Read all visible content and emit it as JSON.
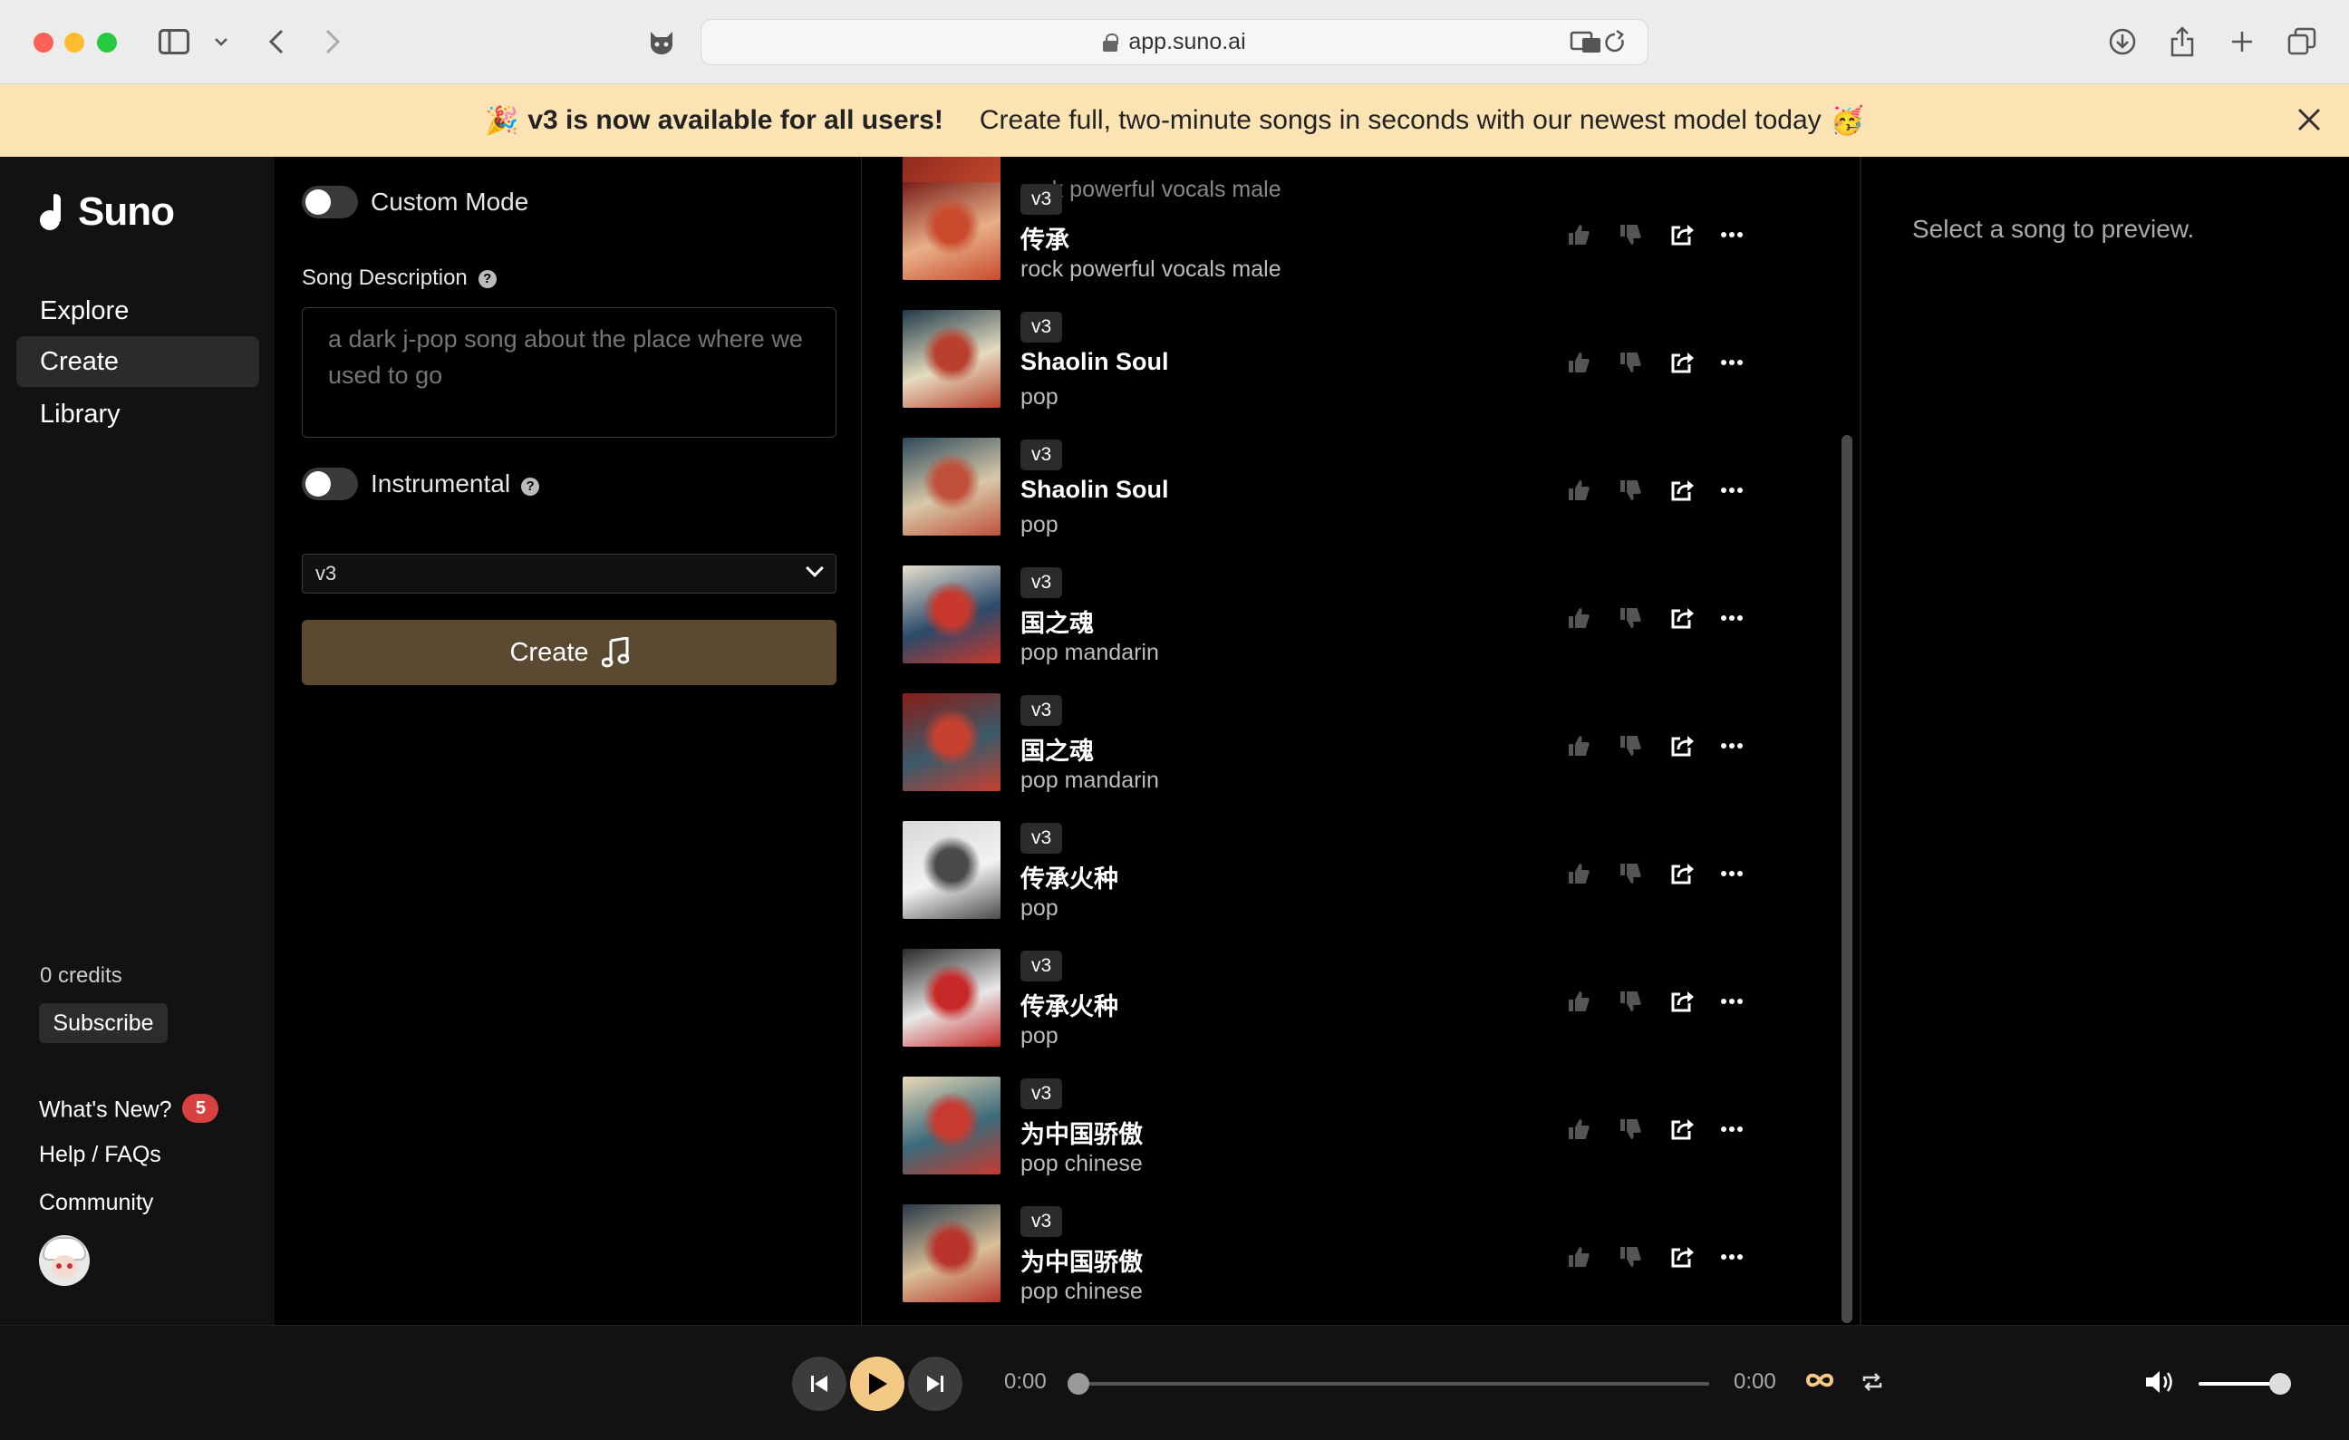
{
  "browser": {
    "url": "app.suno.ai"
  },
  "banner": {
    "highlight": "v3 is now available for all users!",
    "text": "Create full, two-minute songs in seconds with our newest model today",
    "emoji_left": "🎉",
    "emoji_right": "🥳"
  },
  "sidebar": {
    "brand": "Suno",
    "nav": [
      "Explore",
      "Create",
      "Library"
    ],
    "active_nav": "Create",
    "credits": "0 credits",
    "subscribe": "Subscribe",
    "whats_new": "What's New?",
    "whats_new_count": "5",
    "help": "Help / FAQs",
    "community": "Community"
  },
  "create": {
    "custom_mode": "Custom Mode",
    "song_description_label": "Song Description",
    "song_description_placeholder": "a dark j-pop song about the place where we used to go",
    "instrumental": "Instrumental",
    "model_version": "v3",
    "create_button": "Create"
  },
  "songs": {
    "partial_top_style": "rock powerful vocals male",
    "items": [
      {
        "version": "v3",
        "title": "传承",
        "style": "rock powerful vocals male",
        "art": [
          "#7a1e1a",
          "#c94a2c",
          "#e8b088"
        ]
      },
      {
        "version": "v3",
        "title": "Shaolin Soul",
        "style": "pop",
        "art": [
          "#1f3a4a",
          "#b8402c",
          "#e6dcc0"
        ]
      },
      {
        "version": "v3",
        "title": "Shaolin Soul",
        "style": "pop",
        "art": [
          "#2c4a5c",
          "#c0503a",
          "#d8c8a8"
        ]
      },
      {
        "version": "v3",
        "title": "国之魂",
        "style": "pop mandarin",
        "art": [
          "#e8e0d0",
          "#c8382c",
          "#2a4a6a"
        ]
      },
      {
        "version": "v3",
        "title": "国之魂",
        "style": "pop mandarin",
        "art": [
          "#8a1c18",
          "#c84030",
          "#3a5a6a"
        ]
      },
      {
        "version": "v3",
        "title": "传承火种",
        "style": "pop",
        "art": [
          "#d8d8d8",
          "#4a4a4a",
          "#f2f2f2"
        ]
      },
      {
        "version": "v3",
        "title": "传承火种",
        "style": "pop",
        "art": [
          "#2a2a2a",
          "#c82828",
          "#e8e8e8"
        ]
      },
      {
        "version": "v3",
        "title": "为中国骄傲",
        "style": "pop chinese",
        "art": [
          "#e8d8b8",
          "#c83a30",
          "#3a6a7a"
        ]
      },
      {
        "version": "v3",
        "title": "为中国骄傲",
        "style": "pop chinese",
        "art": [
          "#2a3a4a",
          "#b8342c",
          "#d8c098"
        ]
      }
    ]
  },
  "preview": {
    "empty_text": "Select a song to preview."
  },
  "player": {
    "current_time": "0:00",
    "total_time": "0:00",
    "progress": 0,
    "volume": 0.9,
    "accent": "#f4c986"
  }
}
